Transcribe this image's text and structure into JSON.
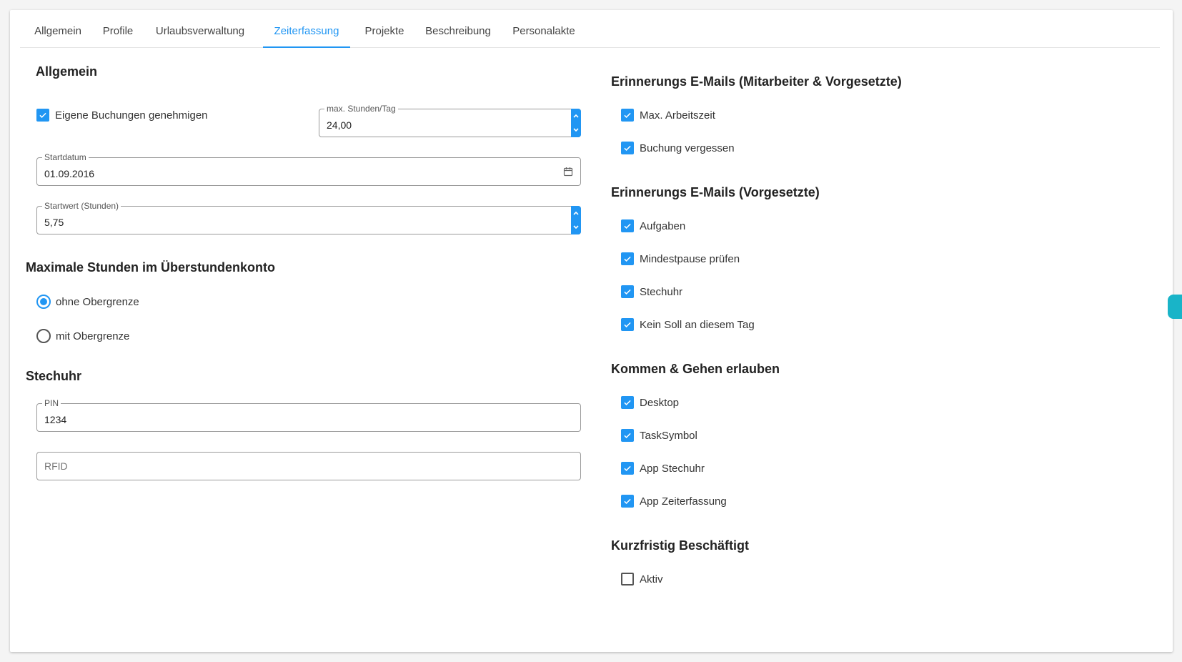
{
  "tabs": [
    {
      "label": "Allgemein"
    },
    {
      "label": "Profile"
    },
    {
      "label": "Urlaubsverwaltung"
    },
    {
      "label": "Zeiterfassung"
    },
    {
      "label": "Projekte"
    },
    {
      "label": "Beschreibung"
    },
    {
      "label": "Personalakte"
    }
  ],
  "active_tab": "Zeiterfassung",
  "accent_color": "#2196f3",
  "left": {
    "general": {
      "title": "Allgemein",
      "own_bookings_label": "Eigene Buchungen genehmigen",
      "own_bookings_checked": true,
      "max_hours": {
        "label": "max. Stunden/Tag",
        "value": "24,00"
      },
      "start_date": {
        "label": "Startdatum",
        "value": "01.09.2016"
      },
      "start_value": {
        "label": "Startwert (Stunden)",
        "value": "5,75"
      }
    },
    "overtime": {
      "title": "Maximale Stunden im Überstundenkonto",
      "options": [
        {
          "label": "ohne Obergrenze",
          "selected": true
        },
        {
          "label": "mit Obergrenze",
          "selected": false
        }
      ]
    },
    "clock": {
      "title": "Stechuhr",
      "pin": {
        "label": "PIN",
        "value": "1234"
      },
      "rfid": {
        "placeholder": "RFID",
        "value": ""
      }
    }
  },
  "right": {
    "sections": [
      {
        "title": "Erinnerungs E-Mails (Mitarbeiter & Vorgesetzte)",
        "items": [
          {
            "label": "Max. Arbeitszeit",
            "checked": true
          },
          {
            "label": "Buchung vergessen",
            "checked": true
          }
        ]
      },
      {
        "title": "Erinnerungs E-Mails (Vorgesetzte)",
        "items": [
          {
            "label": "Aufgaben",
            "checked": true
          },
          {
            "label": "Mindestpause prüfen",
            "checked": true
          },
          {
            "label": "Stechuhr",
            "checked": true
          },
          {
            "label": "Kein Soll an diesem Tag",
            "checked": true
          }
        ]
      },
      {
        "title": "Kommen & Gehen erlauben",
        "items": [
          {
            "label": "Desktop",
            "checked": true
          },
          {
            "label": "TaskSymbol",
            "checked": true
          },
          {
            "label": "App Stechuhr",
            "checked": true
          },
          {
            "label": "App Zeiterfassung",
            "checked": true
          }
        ]
      },
      {
        "title": "Kurzfristig Beschäftigt",
        "items": [
          {
            "label": "Aktiv",
            "checked": false
          }
        ]
      }
    ]
  }
}
